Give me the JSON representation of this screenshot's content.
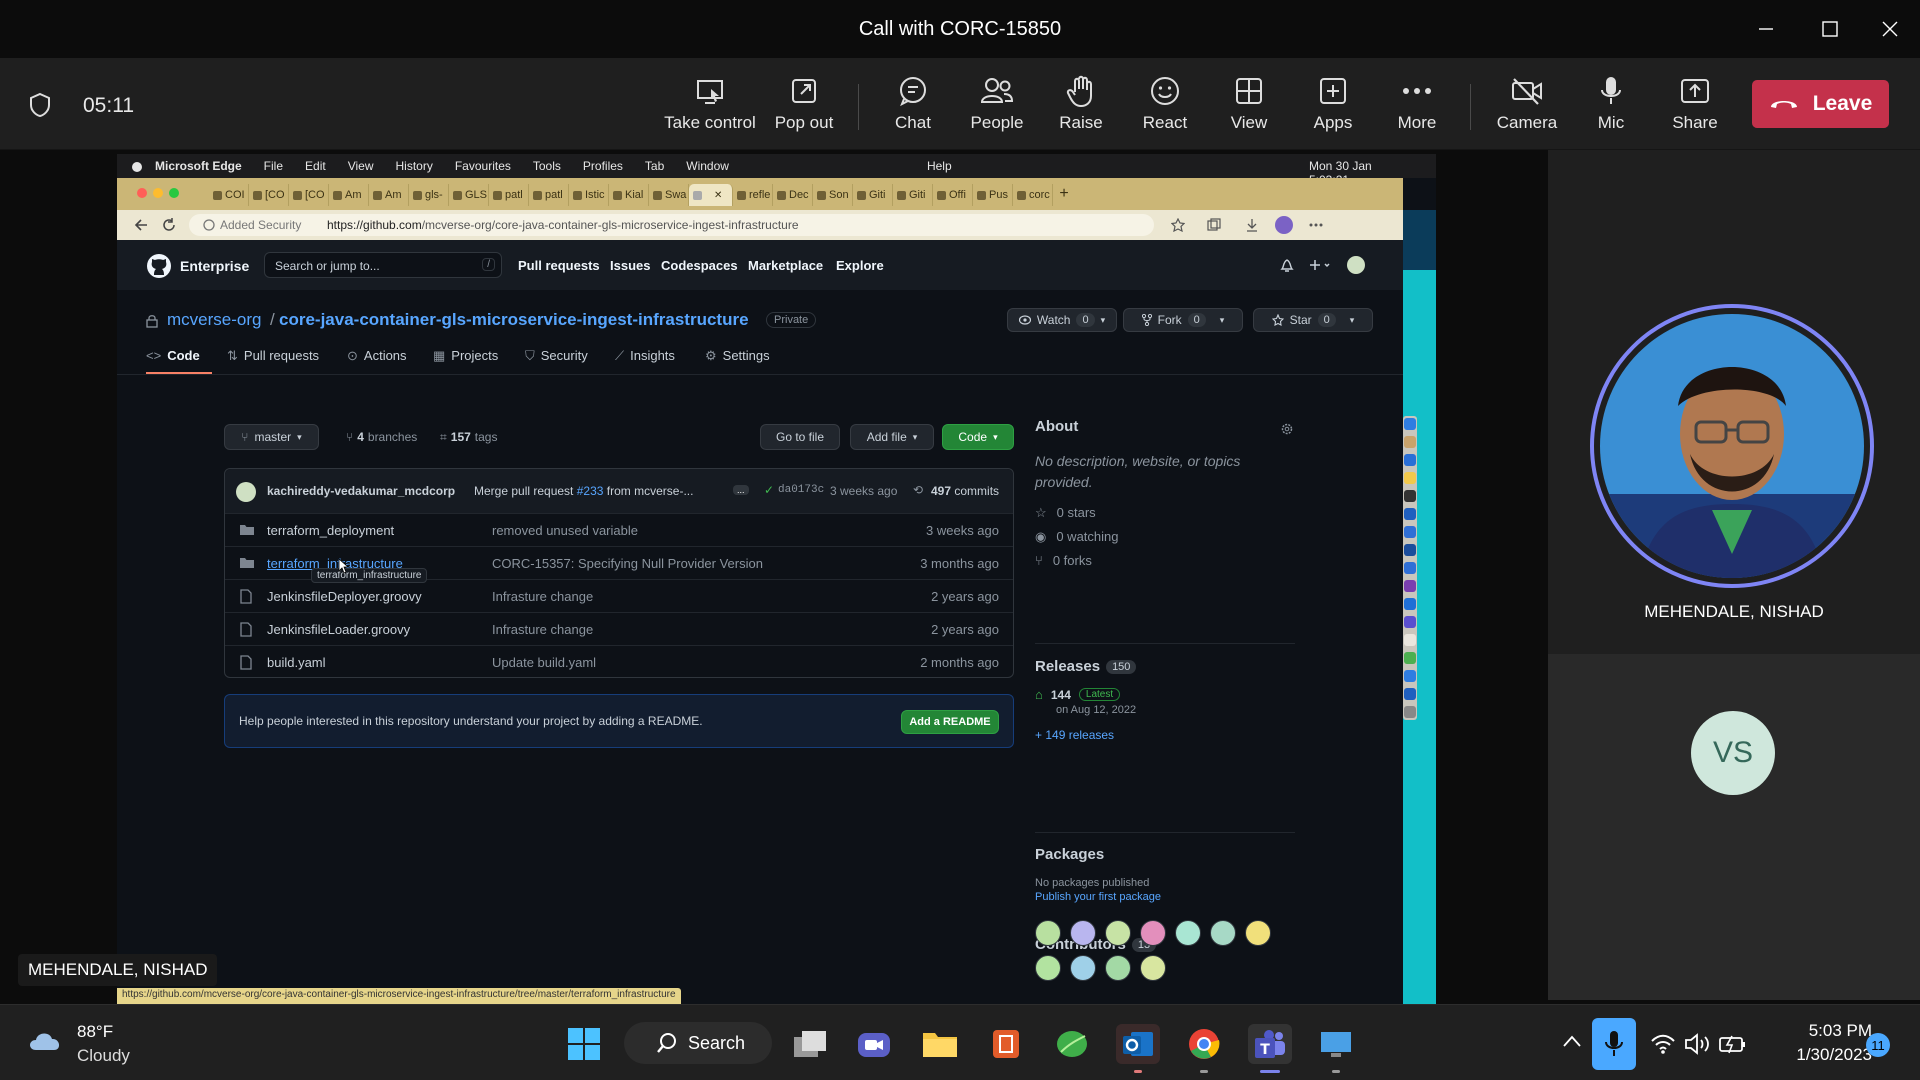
{
  "window": {
    "title": "Call with CORC-15850"
  },
  "call": {
    "timer": "05:11",
    "buttons": {
      "take_control": "Take control",
      "pop_out": "Pop out",
      "chat": "Chat",
      "people": "People",
      "raise": "Raise",
      "react": "React",
      "view": "View",
      "apps": "Apps",
      "more": "More",
      "camera": "Camera",
      "mic": "Mic",
      "share": "Share",
      "leave": "Leave"
    },
    "presenter_label": "MEHENDALE, NISHAD",
    "participant_main": "MEHENDALE, NISHAD",
    "participant_initials": "VS"
  },
  "mac_menu": {
    "app": "Microsoft Edge",
    "items": [
      "File",
      "Edit",
      "View",
      "History",
      "Favourites",
      "Tools",
      "Profiles",
      "Tab",
      "Window",
      "Help"
    ],
    "datetime": "Mon 30 Jan  5:03:21"
  },
  "browser": {
    "tabs": [
      "COI",
      "[CO",
      "[CO",
      "Am",
      "Am",
      "gls-",
      "GLS",
      "patl",
      "patl",
      "Istic",
      "Kial",
      "Swa",
      "",
      "refle",
      "Dec",
      "Son",
      "Giti",
      "Giti",
      "Offi",
      "Pus",
      "corc"
    ],
    "security_label": "Added Security",
    "url_prefix": "https://github.com",
    "url_path": "/mcverse-org/core-java-container-gls-microservice-ingest-infrastructure",
    "status_url": "https://github.com/mcverse-org/core-java-container-gls-microservice-ingest-infrastructure/tree/master/terraform_infrastructure"
  },
  "github": {
    "brand": "Enterprise",
    "search_placeholder": "Search or jump to...",
    "search_key": "/",
    "nav": [
      "Pull requests",
      "Issues",
      "Codespaces",
      "Marketplace",
      "Explore"
    ],
    "owner": "mcverse-org",
    "slash": "/",
    "repo": "core-java-container-gls-microservice-ingest-infrastructure",
    "visibility": "Private",
    "watch": {
      "label": "Watch",
      "count": "0"
    },
    "fork": {
      "label": "Fork",
      "count": "0"
    },
    "star": {
      "label": "Star",
      "count": "0"
    },
    "tabs": [
      "Code",
      "Pull requests",
      "Actions",
      "Projects",
      "Security",
      "Insights",
      "Settings"
    ],
    "branch": "master",
    "branches_count": "4",
    "branches_label": "branches",
    "tags_count": "157",
    "tags_label": "tags",
    "go_to_file": "Go to file",
    "add_file": "Add file",
    "code_btn": "Code",
    "commit": {
      "author": "kachireddy-vedakumar_mcdcorp",
      "message_prefix": "Merge pull request",
      "pr": "#233",
      "message_suffix": "from mcverse-...",
      "ellipsis": "...",
      "sha": "da0173c",
      "age": "3 weeks ago",
      "count": "497",
      "count_label": "commits"
    },
    "files": [
      {
        "name": "terraform_deployment",
        "message": "removed unused variable",
        "age": "3 weeks ago",
        "type": "dir"
      },
      {
        "name": "terraform_infrastructure",
        "message": "CORC-15357: Specifying Null Provider Version",
        "age": "3 months ago",
        "type": "dir"
      },
      {
        "name": "JenkinsfileDeployer.groovy",
        "message": "Infrasture change",
        "age": "2 years ago",
        "type": "file"
      },
      {
        "name": "JenkinsfileLoader.groovy",
        "message": "Infrasture change",
        "age": "2 years ago",
        "type": "file"
      },
      {
        "name": "build.yaml",
        "message": "Update build.yaml",
        "age": "2 months ago",
        "type": "file"
      }
    ],
    "tooltip": "terraform_infrastructure",
    "readme_prompt": "Help people interested in this repository understand your project by adding a README.",
    "add_readme": "Add a README",
    "about": {
      "title": "About",
      "description": "No description, website, or topics provided.",
      "stars": "0 stars",
      "watching": "0 watching",
      "forks": "0 forks"
    },
    "releases": {
      "title": "Releases",
      "count": "150",
      "latest_tag": "144",
      "latest_badge": "Latest",
      "latest_date": "on Aug 12, 2022",
      "more": "+ 149 releases"
    },
    "packages": {
      "title": "Packages",
      "none": "No packages published",
      "publish": "Publish your first package"
    },
    "contributors": {
      "title": "Contributors",
      "count": "13"
    }
  },
  "weather": {
    "temp": "88°F",
    "condition": "Cloudy"
  },
  "taskbar": {
    "search": "Search",
    "time": "5:03 PM",
    "date": "1/30/2023",
    "notifications": "11"
  },
  "colors": {
    "leave": "#c4314b",
    "teams_accent": "#7f85f5",
    "github_link": "#58a6ff",
    "github_green": "#238636"
  }
}
